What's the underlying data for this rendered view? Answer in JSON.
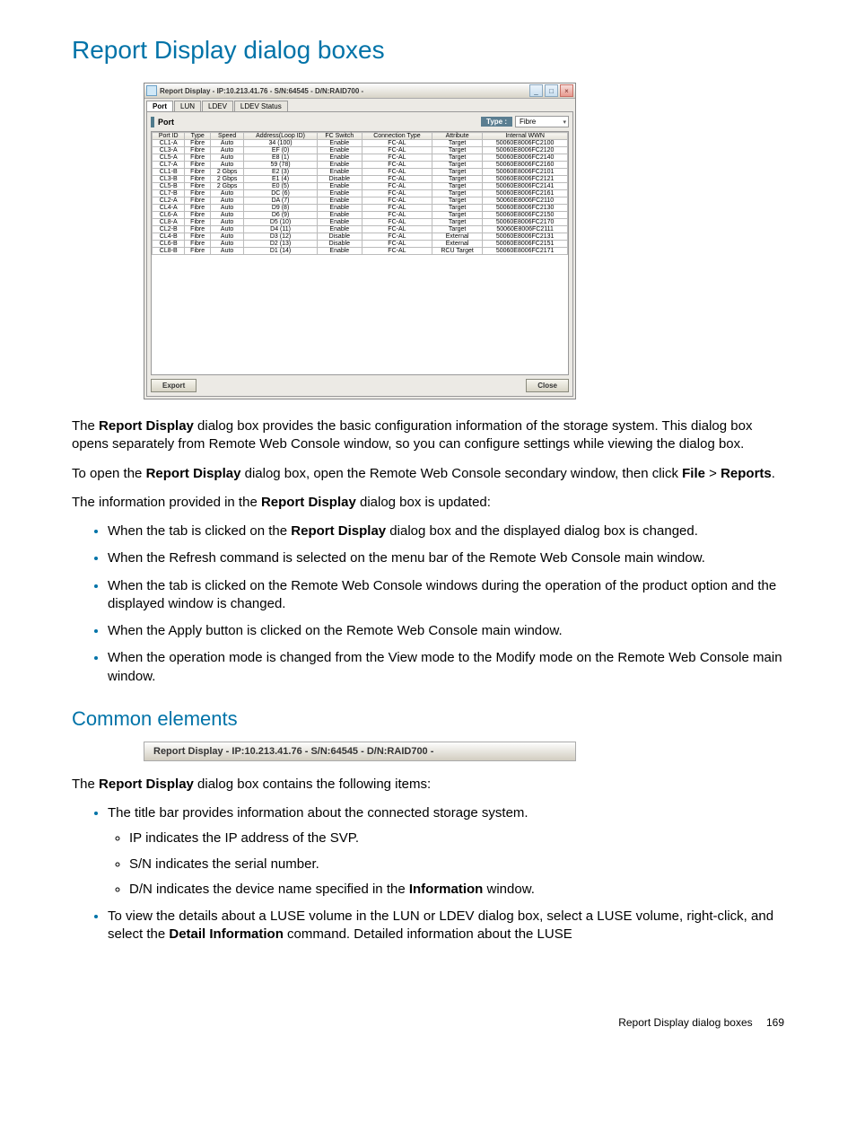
{
  "page": {
    "title": "Report Display dialog boxes",
    "section2": "Common elements",
    "footer_text": "Report Display dialog boxes",
    "page_number": "169"
  },
  "dialog": {
    "title": "Report Display - IP:10.213.41.76 - S/N:64545 - D/N:RAID700 -",
    "tabs": [
      "Port",
      "LUN",
      "LDEV",
      "LDEV Status"
    ],
    "panel_title": "Port",
    "type_label": "Type :",
    "type_value": "Fibre",
    "export_btn": "Export",
    "close_btn": "Close",
    "columns": [
      "Port ID",
      "Type",
      "Speed",
      "Address(Loop ID)",
      "FC Switch",
      "Connection Type",
      "Attribute",
      "Internal WWN"
    ],
    "rows": [
      [
        "CL1-A",
        "Fibre",
        "Auto",
        "34 (100)",
        "Enable",
        "FC-AL",
        "Target",
        "50060E8006FC2100"
      ],
      [
        "CL3-A",
        "Fibre",
        "Auto",
        "EF (0)",
        "Enable",
        "FC-AL",
        "Target",
        "50060E8006FC2120"
      ],
      [
        "CL5-A",
        "Fibre",
        "Auto",
        "E8 (1)",
        "Enable",
        "FC-AL",
        "Target",
        "50060E8006FC2140"
      ],
      [
        "CL7-A",
        "Fibre",
        "Auto",
        "59 (78)",
        "Enable",
        "FC-AL",
        "Target",
        "50060E8006FC2160"
      ],
      [
        "CL1-B",
        "Fibre",
        "2 Gbps",
        "E2 (3)",
        "Enable",
        "FC-AL",
        "Target",
        "50060E8006FC2101"
      ],
      [
        "CL3-B",
        "Fibre",
        "2 Gbps",
        "E1 (4)",
        "Disable",
        "FC-AL",
        "Target",
        "50060E8006FC2121"
      ],
      [
        "CL5-B",
        "Fibre",
        "2 Gbps",
        "E0 (5)",
        "Enable",
        "FC-AL",
        "Target",
        "50060E8006FC2141"
      ],
      [
        "CL7-B",
        "Fibre",
        "Auto",
        "DC (6)",
        "Enable",
        "FC-AL",
        "Target",
        "50060E8006FC2161"
      ],
      [
        "CL2-A",
        "Fibre",
        "Auto",
        "DA (7)",
        "Enable",
        "FC-AL",
        "Target",
        "50060E8006FC2110"
      ],
      [
        "CL4-A",
        "Fibre",
        "Auto",
        "D9 (8)",
        "Enable",
        "FC-AL",
        "Target",
        "50060E8006FC2130"
      ],
      [
        "CL6-A",
        "Fibre",
        "Auto",
        "D6 (9)",
        "Enable",
        "FC-AL",
        "Target",
        "50060E8006FC2150"
      ],
      [
        "CL8-A",
        "Fibre",
        "Auto",
        "D5 (10)",
        "Enable",
        "FC-AL",
        "Target",
        "50060E8006FC2170"
      ],
      [
        "CL2-B",
        "Fibre",
        "Auto",
        "D4 (11)",
        "Enable",
        "FC-AL",
        "Target",
        "50060E8006FC2111"
      ],
      [
        "CL4-B",
        "Fibre",
        "Auto",
        "D3 (12)",
        "Disable",
        "FC-AL",
        "External",
        "50060E8006FC2131"
      ],
      [
        "CL6-B",
        "Fibre",
        "Auto",
        "D2 (13)",
        "Disable",
        "FC-AL",
        "External",
        "50060E8006FC2151"
      ],
      [
        "CL8-B",
        "Fibre",
        "Auto",
        "D1 (14)",
        "Enable",
        "FC-AL",
        "RCU Target",
        "50060E8006FC2171"
      ]
    ]
  },
  "body": {
    "p1_a": "The ",
    "p1_b": "Report Display",
    "p1_c": " dialog box provides the basic configuration information of the storage system. This dialog box opens separately from Remote Web Console window, so you can configure settings while viewing the dialog box.",
    "p2_a": "To open the ",
    "p2_b": "Report Display",
    "p2_c": " dialog box, open the Remote Web Console secondary window, then click ",
    "p2_d": "File",
    "p2_e": " > ",
    "p2_f": "Reports",
    "p2_g": ".",
    "p3_a": "The information provided in the ",
    "p3_b": "Report Display",
    "p3_c": " dialog box is updated:",
    "li1_a": "When the tab is clicked on the ",
    "li1_b": "Report Display",
    "li1_c": " dialog box and the displayed dialog box is changed.",
    "li2": "When the Refresh command is selected on the menu bar of the Remote Web Console main window.",
    "li3": "When the tab is clicked on the Remote Web Console windows during the operation of the product option and the displayed window is changed.",
    "li4": "When the Apply button is clicked on the Remote Web Console main window.",
    "li5": "When the operation mode is changed from the View mode to the Modify mode on the Remote Web Console main window."
  },
  "common": {
    "titlebar_text": "Report Display - IP:10.213.41.76 - S/N:64545 - D/N:RAID700 -",
    "p1_a": "The ",
    "p1_b": "Report Display",
    "p1_c": " dialog box contains the following items:",
    "li1": "The title bar provides information about the connected storage system.",
    "li1a": "IP indicates the IP address of the SVP.",
    "li1b": "S/N indicates the serial number.",
    "li1c_a": "D/N indicates the device name specified in the ",
    "li1c_b": "Information",
    "li1c_c": " window.",
    "li2_a": "To view the details about a LUSE volume in the LUN or LDEV dialog box, select a LUSE volume, right-click, and select the ",
    "li2_b": "Detail Information",
    "li2_c": " command. Detailed information about the LUSE"
  }
}
